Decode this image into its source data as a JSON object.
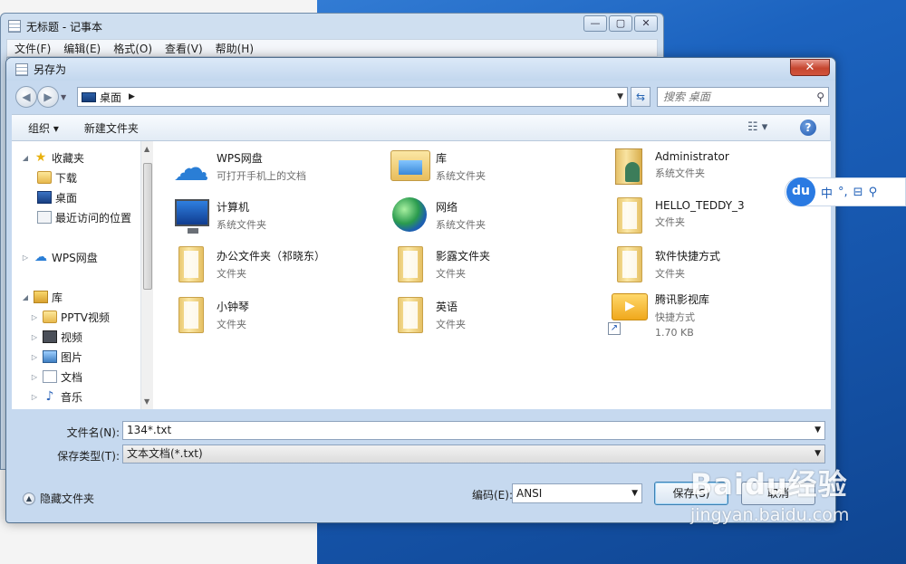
{
  "notepad": {
    "title": "无标题 - 记事本",
    "menu": [
      "文件(F)",
      "编辑(E)",
      "格式(O)",
      "查看(V)",
      "帮助(H)"
    ],
    "controls": [
      "—",
      "▢",
      "✕"
    ]
  },
  "dialog": {
    "title": "另存为",
    "close": "✕",
    "address": {
      "location": "桌面",
      "search_placeholder": "搜索 桌面"
    },
    "toolbar": {
      "organize": "组织 ▾",
      "new_folder": "新建文件夹",
      "help": "?"
    },
    "nav_pane": {
      "items": [
        {
          "label": "收藏夹",
          "icon": "star-icon"
        },
        {
          "label": "下载",
          "icon": "download-folder-icon"
        },
        {
          "label": "桌面",
          "icon": "desktop-icon"
        },
        {
          "label": "最近访问的位置",
          "icon": "recent-places-icon"
        },
        {
          "label": "WPS网盘",
          "icon": "cloud-icon"
        },
        {
          "label": "库",
          "icon": "library-icon"
        },
        {
          "label": "PPTV视频",
          "icon": "folder-icon"
        },
        {
          "label": "视频",
          "icon": "video-icon"
        },
        {
          "label": "图片",
          "icon": "pictures-icon"
        },
        {
          "label": "文档",
          "icon": "documents-icon"
        },
        {
          "label": "音乐",
          "icon": "music-icon"
        }
      ]
    },
    "files": [
      {
        "name": "WPS网盘",
        "sub": "可打开手机上的文档",
        "icon": "cloud-icon"
      },
      {
        "name": "库",
        "sub": "系统文件夹",
        "icon": "library-icon"
      },
      {
        "name": "Administrator",
        "sub": "系统文件夹",
        "icon": "user-folder-icon"
      },
      {
        "name": "计算机",
        "sub": "系统文件夹",
        "icon": "computer-icon"
      },
      {
        "name": "网络",
        "sub": "系统文件夹",
        "icon": "network-icon"
      },
      {
        "name": "HELLO_TEDDY_3",
        "sub": "文件夹",
        "icon": "folder-icon"
      },
      {
        "name": "办公文件夹（祁晓东）",
        "sub": "文件夹",
        "icon": "folder-icon"
      },
      {
        "name": "影露文件夹",
        "sub": "文件夹",
        "icon": "folder-icon"
      },
      {
        "name": "软件快捷方式",
        "sub": "文件夹",
        "icon": "folder-icon"
      },
      {
        "name": "小钟琴",
        "sub": "文件夹",
        "icon": "folder-icon"
      },
      {
        "name": "英语",
        "sub": "文件夹",
        "icon": "folder-icon"
      },
      {
        "name": "腾讯影视库",
        "sub": "快捷方式",
        "size": "1.70 KB",
        "icon": "shortcut-icon"
      }
    ],
    "filename": {
      "label": "文件名(N):",
      "value": "134*.txt"
    },
    "filetype": {
      "label": "保存类型(T):",
      "value": "文本文档(*.txt)"
    },
    "hide_folders": "隐藏文件夹",
    "encoding": {
      "label": "编码(E):",
      "value": "ANSI"
    },
    "buttons": {
      "save": "保存(S)",
      "cancel": "取消"
    }
  },
  "ime": {
    "logo": "du",
    "items": [
      "中",
      "°,",
      "⊟",
      "⚲"
    ]
  },
  "watermark": {
    "logo": "Baidu经验",
    "url": "jingyan.baidu.com"
  }
}
